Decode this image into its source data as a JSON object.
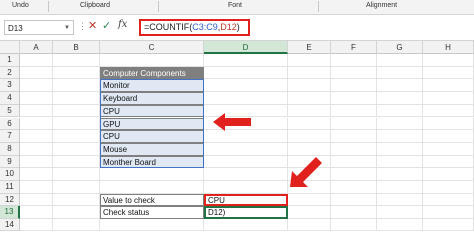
{
  "ribbon": {
    "groups": [
      "Undo",
      "Clipboard",
      "Font",
      "Alignment"
    ]
  },
  "formula_bar": {
    "name_box": "D13",
    "fx_label": "fx",
    "formula_prefix": "=COUNTIF(",
    "formula_range": "C3:C9",
    "formula_comma": ",",
    "formula_ref": "D12",
    "formula_suffix": ")"
  },
  "columns": [
    "A",
    "B",
    "C",
    "D",
    "E",
    "F",
    "G",
    "H"
  ],
  "rows": [
    "1",
    "2",
    "3",
    "4",
    "5",
    "6",
    "7",
    "8",
    "9",
    "10",
    "11",
    "12",
    "13",
    "14"
  ],
  "table": {
    "header": "Computer Components",
    "items": [
      "Monitor",
      "Keyboard",
      "CPU",
      "GPU",
      "CPU",
      "Mouse",
      "Monther Board"
    ]
  },
  "check": {
    "value_label": "Value to check",
    "value": "CPU",
    "status_label": "Check status",
    "status_value": "D12)"
  },
  "colors": {
    "accent_red": "#e0211d",
    "excel_green": "#217346",
    "range_blue": "#4472c4"
  }
}
